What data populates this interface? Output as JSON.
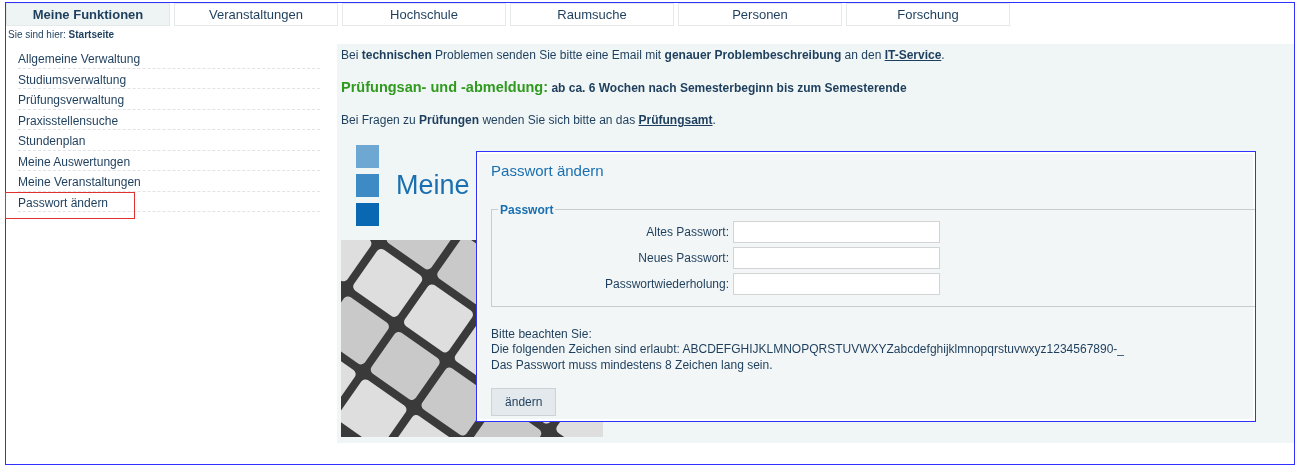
{
  "tabs": [
    {
      "label": "Meine Funktionen",
      "selected": true
    },
    {
      "label": "Veranstaltungen",
      "selected": false
    },
    {
      "label": "Hochschule",
      "selected": false
    },
    {
      "label": "Raumsuche",
      "selected": false
    },
    {
      "label": "Personen",
      "selected": false
    },
    {
      "label": "Forschung",
      "selected": false
    }
  ],
  "breadcrumb": {
    "label": "Sie sind hier:",
    "current": "Startseite"
  },
  "sidebar": {
    "items": [
      {
        "label": "Allgemeine Verwaltung",
        "selected": false
      },
      {
        "label": "Studiumsverwaltung",
        "selected": false
      },
      {
        "label": "Prüfungsverwaltung",
        "selected": false
      },
      {
        "label": "Praxisstellensuche",
        "selected": false
      },
      {
        "label": "Stundenplan",
        "selected": false
      },
      {
        "label": "Meine Auswertungen",
        "selected": false
      },
      {
        "label": "Meine Veranstaltungen",
        "selected": false
      },
      {
        "label": "Passwort ändern",
        "selected": true
      }
    ]
  },
  "notices": [
    {
      "kind": "text",
      "text": "Bei **technischen** Problemen senden Sie bitte eine Email mit **genauer Problembeschreibung** an den ",
      "link": "IT-Service",
      "after": "."
    },
    {
      "kind": "highlight",
      "title": "Prüfungsan- und -abmeldung:",
      "text": "ab ca. 6 Wochen nach Semesterbeginn bis zum Semesterende"
    },
    {
      "kind": "text",
      "text": "Bei Fragen zu **Prüfungen** wenden Sie sich bitte an das ",
      "link": "Prüfungsamt",
      "after": "."
    }
  ],
  "banner": {
    "title": "Meine"
  },
  "dialog": {
    "title": "Passwort ändern",
    "legend": "Passwort",
    "fields": [
      {
        "label": "Altes Passwort:"
      },
      {
        "label": "Neues Passwort:"
      },
      {
        "label": "Passwortwiederholung:"
      }
    ],
    "notes": [
      "Bitte beachten Sie:",
      "Die folgenden Zeichen sind erlaubt: ABCDEFGHIJKLMNOPQRSTUVWXYZabcdefghijklmnopqrstuvwxyz1234567890-_",
      "Das Passwort muss mindestens 8 Zeichen lang sein."
    ],
    "button": "ändern"
  }
}
